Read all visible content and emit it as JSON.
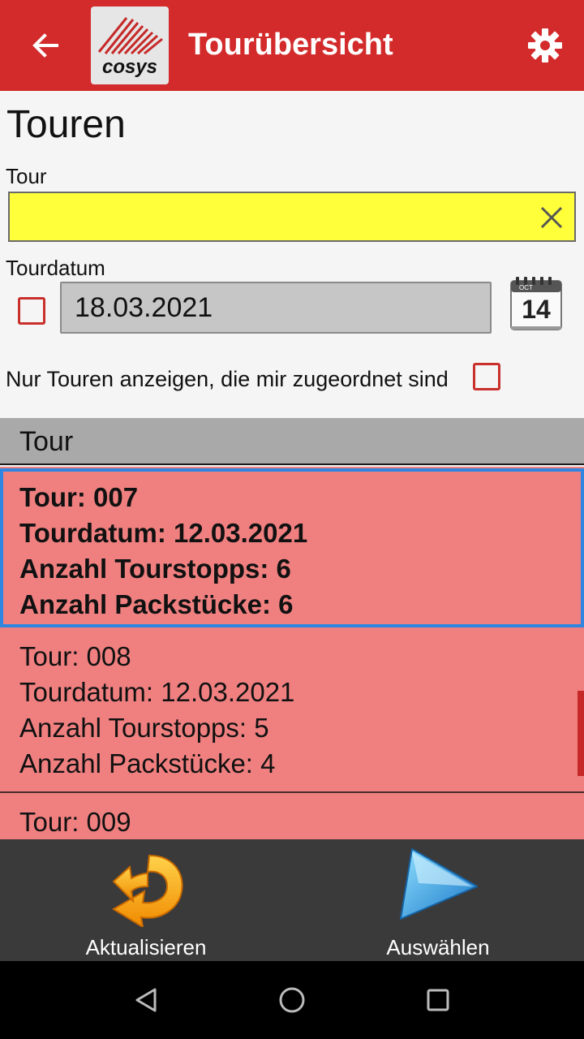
{
  "appbar": {
    "title": "Tourübersicht",
    "back_icon": "arrow-left-icon",
    "settings_icon": "gear-icon",
    "logo_text": "cosys",
    "color": "#d32b2b"
  },
  "page": {
    "title": "Touren"
  },
  "tour_field": {
    "label": "Tour",
    "value": "",
    "clear_icon": "close-icon",
    "background": "#ffff3a"
  },
  "date_field": {
    "label": "Tourdatum",
    "checked": false,
    "value": "18.03.2021",
    "calendar_icon": "calendar-icon",
    "calendar_month": "OCT",
    "calendar_day": "14"
  },
  "assigned_filter": {
    "label": "Nur Touren anzeigen, die mir zugeordnet sind",
    "checked": false
  },
  "list": {
    "header": "Tour",
    "items": [
      {
        "tour": "Tour: 007",
        "date": "Tourdatum: 12.03.2021",
        "stops": "Anzahl Tourstopps: 6",
        "packages": "Anzahl Packstücke: 6",
        "selected": true
      },
      {
        "tour": "Tour: 008",
        "date": "Tourdatum: 12.03.2021",
        "stops": "Anzahl Tourstopps: 5",
        "packages": "Anzahl Packstücke: 4",
        "selected": false
      },
      {
        "tour": "Tour: 009",
        "selected": false
      }
    ]
  },
  "bottom_bar": {
    "refresh_label": "Aktualisieren",
    "refresh_icon": "refresh-arrow-icon",
    "select_label": "Auswählen",
    "select_icon": "play-arrow-icon"
  },
  "system_nav": {
    "back_icon": "nav-back-icon",
    "home_icon": "nav-home-icon",
    "recents_icon": "nav-recents-icon"
  }
}
